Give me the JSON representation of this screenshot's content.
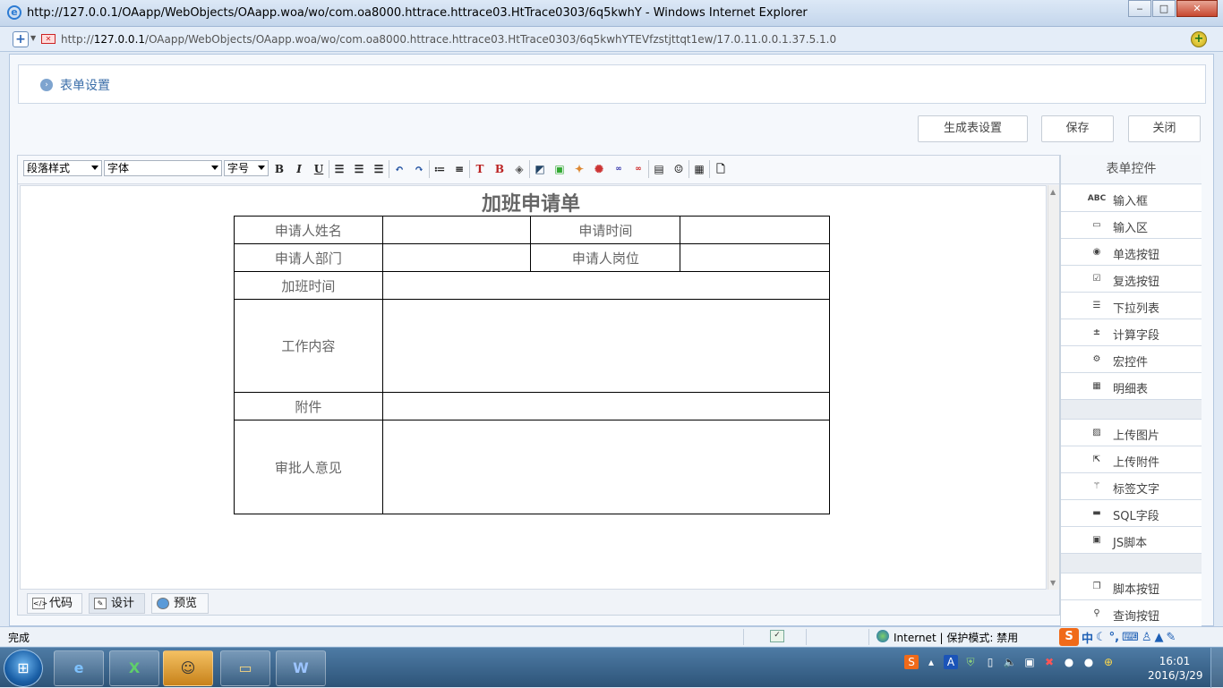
{
  "window": {
    "title": "http://127.0.0.1/OAapp/WebObjects/OAapp.woa/wo/com.oa8000.httrace.httrace03.HtTrace0303/6q5kwhY - Windows Internet Explorer",
    "minimize": "‒",
    "maximize": "□",
    "close": "✕"
  },
  "address": {
    "url_prefix": "http://",
    "url_host": "127.0.0.1",
    "url_path": "/OAapp/WebObjects/OAapp.woa/wo/com.oa8000.httrace.httrace03.HtTrace0303/6q5kwhYTEVfzstjttqt1ew/17.0.11.0.0.1.37.5.1.0"
  },
  "page": {
    "section_title": "表单设置",
    "buttons": {
      "generate": "生成表设置",
      "save": "保存",
      "close": "关闭"
    }
  },
  "toolbar": {
    "paragraph_style": "段落样式",
    "font": "字体",
    "font_size": "字号",
    "bold": "B",
    "italic": "I",
    "underline": "U"
  },
  "form": {
    "title": "加班申请单",
    "rows": [
      [
        "申请人姓名",
        "",
        "申请时间",
        ""
      ],
      [
        "申请人部门",
        "",
        "申请人岗位",
        ""
      ],
      [
        "加班时间",
        ""
      ],
      [
        "工作内容",
        ""
      ],
      [
        "附件",
        ""
      ],
      [
        "审批人意见",
        ""
      ]
    ]
  },
  "modes": {
    "code": "代码",
    "design": "设计",
    "preview": "预览",
    "active": "design"
  },
  "panel": {
    "title": "表单控件",
    "group1": [
      {
        "label": "输入框",
        "icon": "abc-text-icon"
      },
      {
        "label": "输入区",
        "icon": "textarea-icon"
      },
      {
        "label": "单选按钮",
        "icon": "radio-icon"
      },
      {
        "label": "复选按钮",
        "icon": "checkbox-icon"
      },
      {
        "label": "下拉列表",
        "icon": "list-icon"
      },
      {
        "label": "计算字段",
        "icon": "calculator-icon"
      },
      {
        "label": "宏控件",
        "icon": "gear-icon"
      },
      {
        "label": "明细表",
        "icon": "grid-icon"
      }
    ],
    "group2": [
      {
        "label": "上传图片",
        "icon": "image-icon"
      },
      {
        "label": "上传附件",
        "icon": "attach-icon"
      },
      {
        "label": "标签文字",
        "icon": "wand-icon"
      },
      {
        "label": "SQL字段",
        "icon": "folder-icon"
      },
      {
        "label": "JS脚本",
        "icon": "script-icon"
      }
    ],
    "group3": [
      {
        "label": "脚本按钮",
        "icon": "copy-icon"
      },
      {
        "label": "查询按钮",
        "icon": "search-icon"
      }
    ]
  },
  "status": {
    "text": "完成",
    "zone": "Internet | 保护模式: 禁用",
    "ime": "中"
  },
  "taskbar": {
    "time": "16:01",
    "date": "2016/3/29"
  }
}
